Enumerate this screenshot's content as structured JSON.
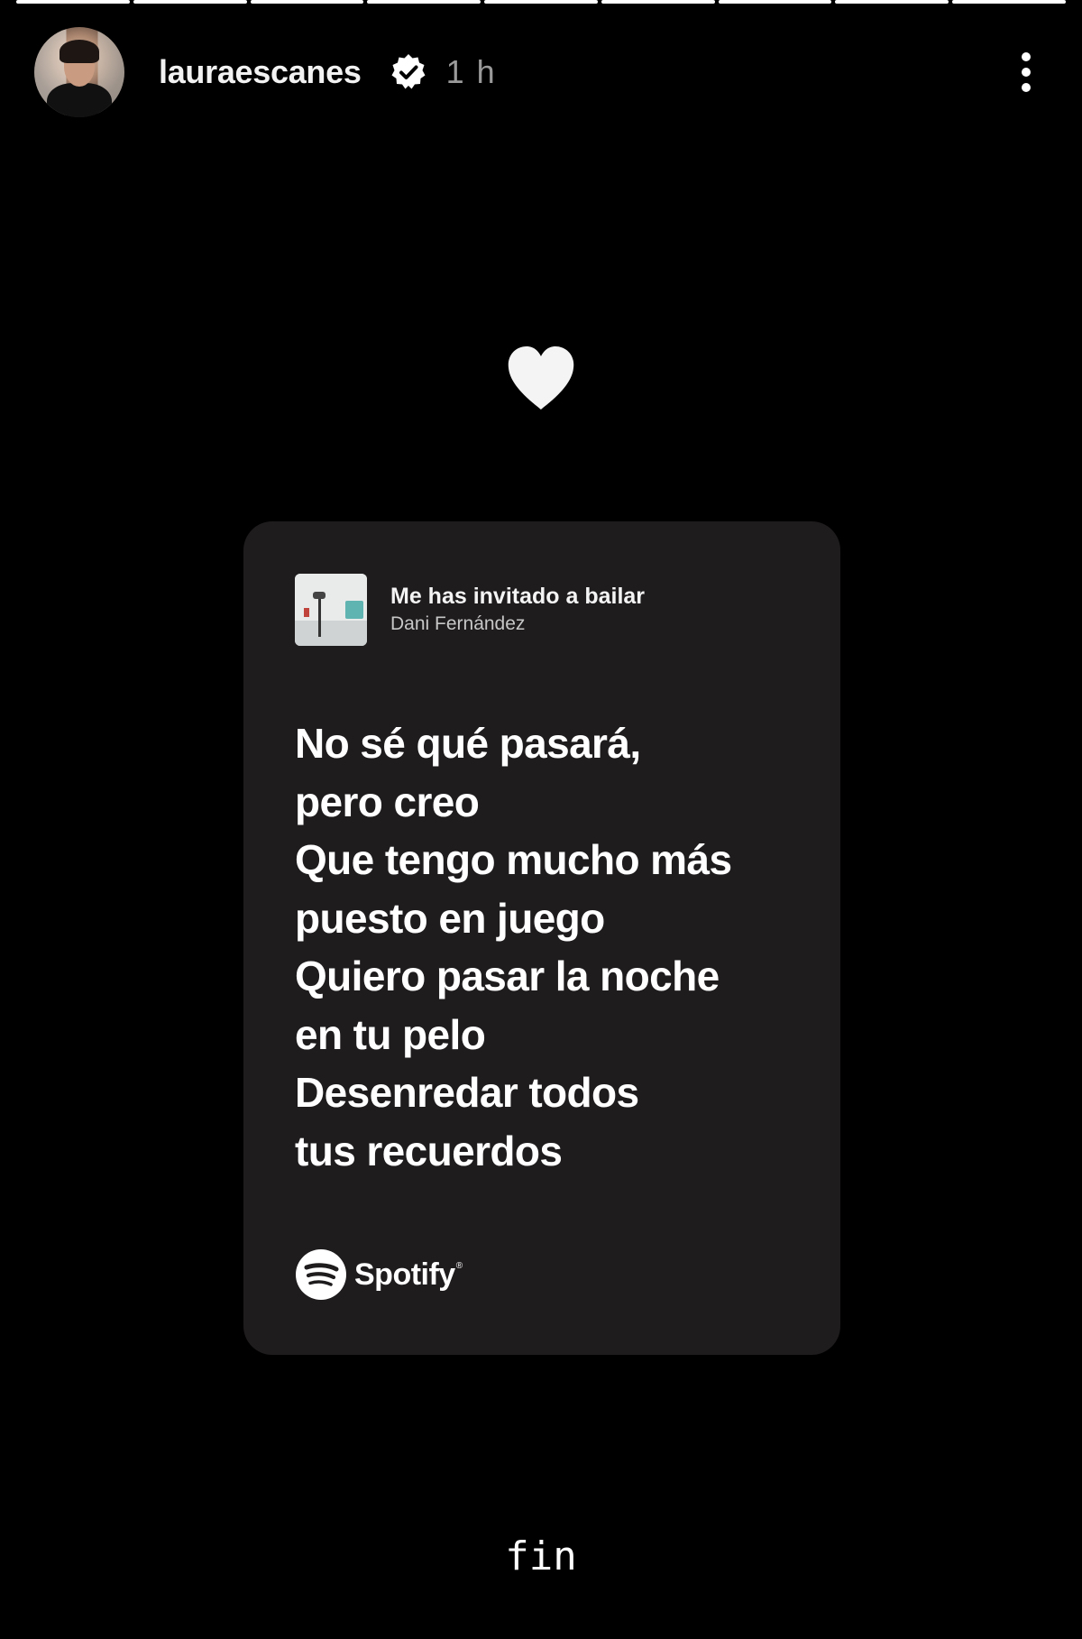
{
  "progress": {
    "segments": 9,
    "completed": 9
  },
  "header": {
    "username": "lauraescanes",
    "time": "1 h",
    "verified_icon": "verified-badge-icon",
    "more_icon": "more-options-icon"
  },
  "story": {
    "emoji": "heart",
    "caption": "fin"
  },
  "card": {
    "track_title": "Me has invitado a bailar",
    "artist": "Dani Fernández",
    "lyrics": [
      "No sé qué pasará,",
      "pero creo",
      "Que tengo mucho más",
      "puesto en juego",
      "Quiero pasar la noche",
      "en tu pelo",
      "Desenredar todos",
      "tus recuerdos"
    ],
    "brand": "Spotify",
    "brand_mark": "®"
  },
  "colors": {
    "background": "#000000",
    "card": "#1f1c1d",
    "text": "#ffffff",
    "muted": "#9a9a9a"
  }
}
